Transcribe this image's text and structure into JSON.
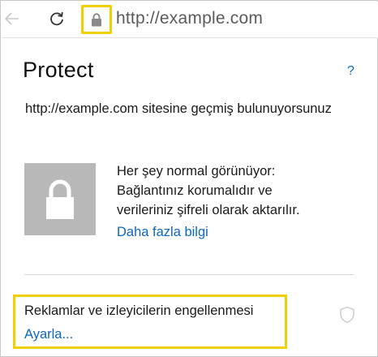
{
  "address_bar": {
    "url": "http://example.com",
    "back_icon": "back-arrow-icon",
    "refresh_icon": "refresh-icon",
    "lock_icon": "lock-icon"
  },
  "panel": {
    "title": "Protect",
    "help_label": "?",
    "site_message": "http://example.com  sitesine geçmiş bulunuyorsunuz",
    "status_line1": "Her şey normal görünüyor:",
    "status_line2": "Bağlantınız korumalıdır ve",
    "status_line3": "verileriniz şifreli olarak aktarılır.",
    "more_info_link": "Daha fazla bilgi",
    "tracker_title": "Reklamlar ve izleyicilerin engellenmesi",
    "tracker_settings_link": "Ayarla..."
  },
  "colors": {
    "highlight": "#f2cf00",
    "link": "#0a67c2",
    "lock_tile": "#b9b9b9"
  }
}
